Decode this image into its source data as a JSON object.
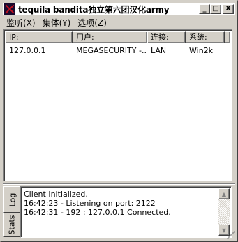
{
  "window": {
    "title": "tequila bandita独立第六团汉化army",
    "buttons": {
      "minimize": "_",
      "maximize": "□",
      "close": "X"
    }
  },
  "menu": {
    "items": [
      {
        "label": "监听(X)"
      },
      {
        "label": "集体(Y)"
      },
      {
        "label": "选项(Z)"
      }
    ]
  },
  "clients_table": {
    "columns": [
      "IP:",
      "用户:",
      "连接:",
      "系统:"
    ],
    "rows": [
      {
        "ip": "127.0.0.1",
        "user": "MEGASECURITY -...",
        "connection": "LAN",
        "system": "Win2k"
      }
    ]
  },
  "tabs": [
    {
      "label": "Log",
      "selected": true
    },
    {
      "label": "Stats",
      "selected": false
    }
  ],
  "log": {
    "lines": [
      "Client Initialized.",
      "16:42:23 - Listening on port: 2122",
      "16:42:31 - 192 : 127.0.0.1 Connected."
    ]
  },
  "colors": {
    "face": "#d4d0c8",
    "icon_bg": "#1a0a2e",
    "icon_mark": "#c01020"
  }
}
